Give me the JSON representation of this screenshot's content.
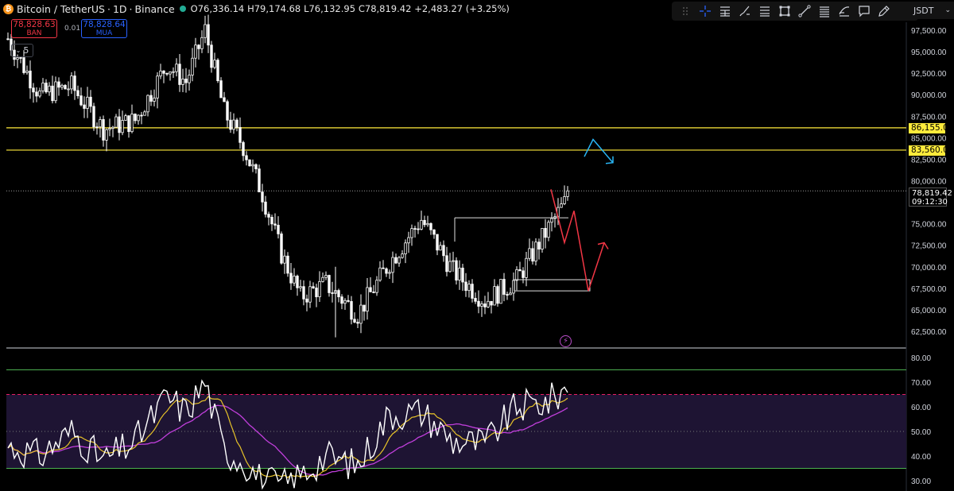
{
  "header": {
    "symbol": "Bitcoin / TetherUS",
    "interval": "1D",
    "exchange": "Binance",
    "separator": "·",
    "open": "O76,336.14",
    "high": "H79,174.68",
    "low": "L76,132.95",
    "close": "C78,819.42",
    "change": "+2,483.27 (+3.25%)",
    "coin_glyph": "₿"
  },
  "trade": {
    "sell_price": "78,828.63",
    "sell_label": "BAN",
    "spread": "0.01",
    "buy_price": "78,828.64",
    "buy_label": "MUA",
    "indicators_count": "5"
  },
  "toolbar": {
    "icons": [
      "drag-handle-icon",
      "crosshair-icon",
      "long-position-icon",
      "brush-icon",
      "fib-retracement-icon",
      "rectangle-icon",
      "trend-line-icon",
      "parallel-channel-icon",
      "regression-trend-icon",
      "callout-icon",
      "pencil-icon"
    ],
    "currency": "USDT",
    "currency_visible": "JSDT"
  },
  "price_axis": {
    "ticks": [
      "97,500.00",
      "95,000.00",
      "92,500.00",
      "90,000.00",
      "87,500.00",
      "85,000.00",
      "82,500.00",
      "80,000.00",
      "75,000.00",
      "72,500.00",
      "70,000.00",
      "67,500.00",
      "65,000.00",
      "62,500.00"
    ],
    "tick_values": [
      97500,
      95000,
      92500,
      90000,
      87500,
      85000,
      82500,
      80000,
      75000,
      72500,
      70000,
      67500,
      65000,
      62500
    ],
    "levels": [
      {
        "label": "86,155.00",
        "value": 86155,
        "color": "#ffeb3b"
      },
      {
        "label": "83,560.00",
        "value": 83560,
        "color": "#ffeb3b"
      }
    ],
    "last_price": "78,819.42",
    "last_value": 78819.42,
    "countdown": "09:12:30"
  },
  "rsi_axis": {
    "ticks": [
      "80.00",
      "70.00",
      "60.00",
      "50.00",
      "40.00",
      "30.00"
    ],
    "tick_values": [
      80,
      70,
      60,
      50,
      40,
      30
    ],
    "upper_band": 65,
    "lower_band": 35,
    "green_upper": 75
  },
  "colors": {
    "background": "#000000",
    "candle": "#ffffff",
    "level": "#ffeb3b",
    "rsi_line": "#ffffff",
    "rsi_ma": "#e6c229",
    "rsi_ma2": "#c13fdc",
    "rsi_band_fill": "#1e1433",
    "arrow_down": "#f23645",
    "arrow_up": "#29b6f6",
    "green_line": "#4caf50"
  },
  "chart_data": {
    "type": "candlestick",
    "symbol": "Bitcoin / TetherUS",
    "interval": "1D",
    "last": 78819.42,
    "ylim": [
      61500,
      99000
    ],
    "close_path": [
      {
        "day": 0,
        "close": 96500
      },
      {
        "day": 10,
        "close": 90000
      },
      {
        "day": 20,
        "close": 91000
      },
      {
        "day": 30,
        "close": 86000
      },
      {
        "day": 40,
        "close": 87000
      },
      {
        "day": 50,
        "close": 93500
      },
      {
        "day": 56,
        "close": 91500
      },
      {
        "day": 62,
        "close": 97500
      },
      {
        "day": 68,
        "close": 88000
      },
      {
        "day": 74,
        "close": 84000
      },
      {
        "day": 80,
        "close": 78500
      },
      {
        "day": 86,
        "close": 71500
      },
      {
        "day": 92,
        "close": 66500
      },
      {
        "day": 100,
        "close": 68000
      },
      {
        "day": 110,
        "close": 64500
      },
      {
        "day": 120,
        "close": 70500
      },
      {
        "day": 130,
        "close": 75500
      },
      {
        "day": 140,
        "close": 69500
      },
      {
        "day": 150,
        "close": 66000
      },
      {
        "day": 160,
        "close": 68500
      },
      {
        "day": 170,
        "close": 74500
      },
      {
        "day": 176,
        "close": 78000
      }
    ],
    "rsi_path": [
      {
        "day": 0,
        "rsi": 44
      },
      {
        "day": 10,
        "rsi": 40
      },
      {
        "day": 20,
        "rsi": 50
      },
      {
        "day": 30,
        "rsi": 38
      },
      {
        "day": 40,
        "rsi": 46
      },
      {
        "day": 50,
        "rsi": 64
      },
      {
        "day": 56,
        "rsi": 58
      },
      {
        "day": 62,
        "rsi": 70
      },
      {
        "day": 68,
        "rsi": 42
      },
      {
        "day": 74,
        "rsi": 38
      },
      {
        "day": 80,
        "rsi": 30
      },
      {
        "day": 86,
        "rsi": 28
      },
      {
        "day": 92,
        "rsi": 32
      },
      {
        "day": 100,
        "rsi": 40
      },
      {
        "day": 110,
        "rsi": 36
      },
      {
        "day": 120,
        "rsi": 57
      },
      {
        "day": 130,
        "rsi": 58
      },
      {
        "day": 140,
        "rsi": 46
      },
      {
        "day": 150,
        "rsi": 45
      },
      {
        "day": 160,
        "rsi": 60
      },
      {
        "day": 170,
        "rsi": 62
      },
      {
        "day": 176,
        "rsi": 68
      }
    ],
    "drawings": {
      "resistance_box_top": 75700,
      "demand_zone_top": 68500,
      "demand_zone_bottom": 67200,
      "red_path": [
        79000,
        72800,
        76500,
        67200,
        72800
      ],
      "blue_path": [
        82800,
        84800,
        82100
      ]
    }
  }
}
